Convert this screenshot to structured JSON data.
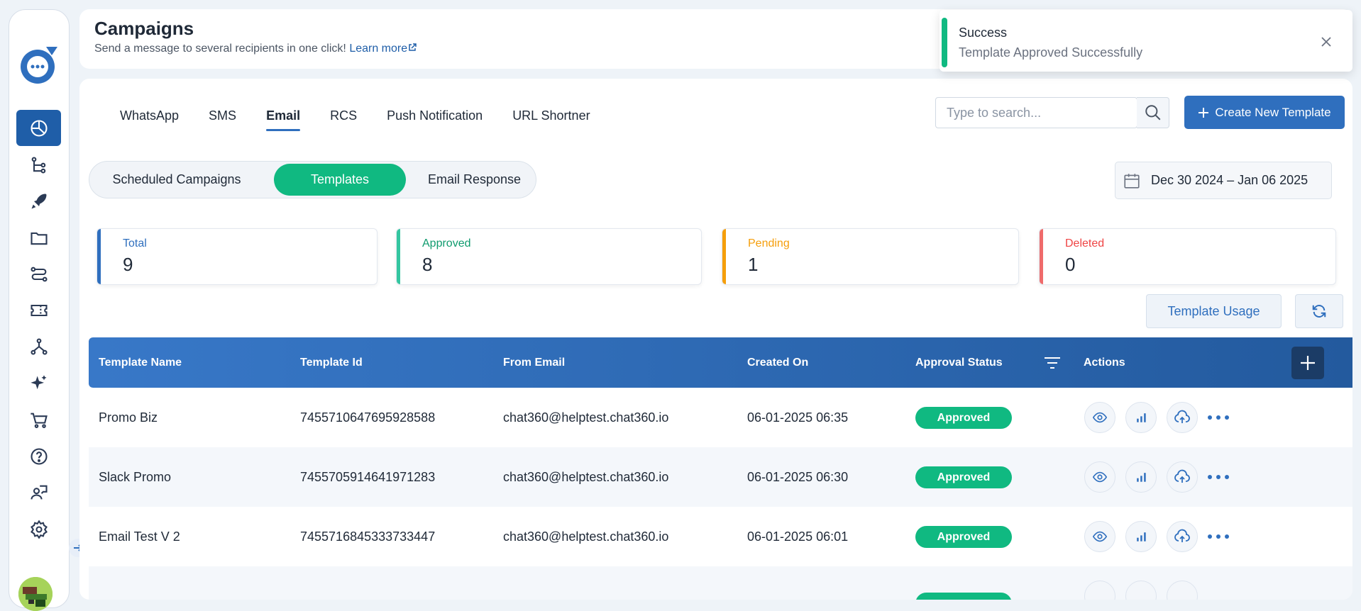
{
  "header": {
    "title": "Campaigns",
    "subtitle": "Send a message to several recipients in one click!",
    "learn_more": "Learn more"
  },
  "toast": {
    "title": "Success",
    "message": "Template Approved Successfully",
    "accent": "#10b981"
  },
  "sidebar": {
    "items": [
      {
        "icon": "pie-chart-icon",
        "active": true
      },
      {
        "icon": "flow-tree-icon"
      },
      {
        "icon": "rocket-icon"
      },
      {
        "icon": "folder-icon"
      },
      {
        "icon": "route-icon"
      },
      {
        "icon": "ticket-icon"
      },
      {
        "icon": "network-icon"
      },
      {
        "icon": "sparkles-icon"
      },
      {
        "icon": "cart-icon"
      },
      {
        "icon": "help-icon"
      },
      {
        "icon": "agent-icon"
      },
      {
        "icon": "settings-icon"
      }
    ]
  },
  "channels": {
    "tabs": [
      "WhatsApp",
      "SMS",
      "Email",
      "RCS",
      "Push Notification",
      "URL Shortner"
    ],
    "active": "Email"
  },
  "search": {
    "placeholder": "Type to search..."
  },
  "create_button": "Create New Template",
  "subtabs": {
    "items": [
      "Scheduled Campaigns",
      "Templates",
      "Email Response"
    ],
    "active": "Templates"
  },
  "date_range": "Dec 30 2024 – Jan 06 2025",
  "stats": [
    {
      "label": "Total",
      "value": "9",
      "color": "#2f6fbe"
    },
    {
      "label": "Approved",
      "value": "8",
      "color": "#10b981"
    },
    {
      "label": "Pending",
      "value": "1",
      "color": "#f59e0b"
    },
    {
      "label": "Deleted",
      "value": "0",
      "color": "#ef4444"
    }
  ],
  "template_usage": "Template Usage",
  "table": {
    "columns": [
      "Template Name",
      "Template Id",
      "From Email",
      "Created On",
      "Approval Status",
      "Actions"
    ],
    "rows": [
      {
        "name": "Promo Biz",
        "id": "7455710647695928588",
        "from": "chat360@helptest.chat360.io",
        "created": "06-01-2025 06:35",
        "status": "Approved"
      },
      {
        "name": "Slack Promo",
        "id": "7455705914641971283",
        "from": "chat360@helptest.chat360.io",
        "created": "06-01-2025 06:30",
        "status": "Approved"
      },
      {
        "name": "Email Test V 2",
        "id": "7455716845333733447",
        "from": "chat360@helptest.chat360.io",
        "created": "06-01-2025 06:01",
        "status": "Approved"
      }
    ]
  }
}
